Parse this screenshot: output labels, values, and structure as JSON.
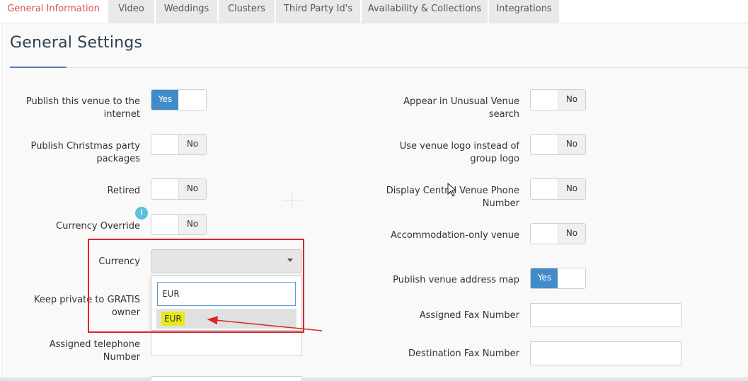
{
  "tabs": [
    {
      "label": "General Information",
      "active": true
    },
    {
      "label": "Video",
      "active": false
    },
    {
      "label": "Weddings",
      "active": false
    },
    {
      "label": "Clusters",
      "active": false
    },
    {
      "label": "Third Party Id's",
      "active": false
    },
    {
      "label": "Availability & Collections",
      "active": false
    },
    {
      "label": "Integrations",
      "active": false
    }
  ],
  "page_title": "General Settings",
  "left_fields": {
    "publish_internet": {
      "label": "Publish this venue to the internet",
      "value": "Yes"
    },
    "publish_christmas": {
      "label": "Publish Christmas party packages",
      "value": "No"
    },
    "retired": {
      "label": "Retired",
      "value": "No"
    },
    "currency_override": {
      "label": "Currency Override",
      "value": "No",
      "info_icon": "info-icon"
    },
    "currency": {
      "label": "Currency",
      "value": ""
    },
    "keep_private": {
      "label": "Keep private to GRATIS owner"
    },
    "assigned_telephone": {
      "label": "Assigned telephone Number",
      "value": ""
    }
  },
  "currency_dropdown": {
    "search_value": "EUR",
    "options": [
      "EUR"
    ]
  },
  "right_fields": {
    "unusual_venue": {
      "label": "Appear in Unusual Venue search",
      "value": "No"
    },
    "venue_logo": {
      "label": "Use venue logo instead of group logo",
      "value": "No"
    },
    "central_phone": {
      "label": "Display Central Venue Phone Number",
      "value": "No"
    },
    "accommodation_only": {
      "label": "Accommodation-only venue",
      "value": "No"
    },
    "address_map": {
      "label": "Publish venue address map",
      "value": "Yes"
    },
    "assigned_fax": {
      "label": "Assigned Fax Number",
      "value": ""
    },
    "destination_fax": {
      "label": "Destination Fax Number",
      "value": ""
    }
  },
  "colors": {
    "active_tab": "#d9534f",
    "toggle_on": "#428bca",
    "annotation_red": "#d9262a",
    "highlight_yellow": "#e6ea1a",
    "info": "#5bc0de"
  }
}
